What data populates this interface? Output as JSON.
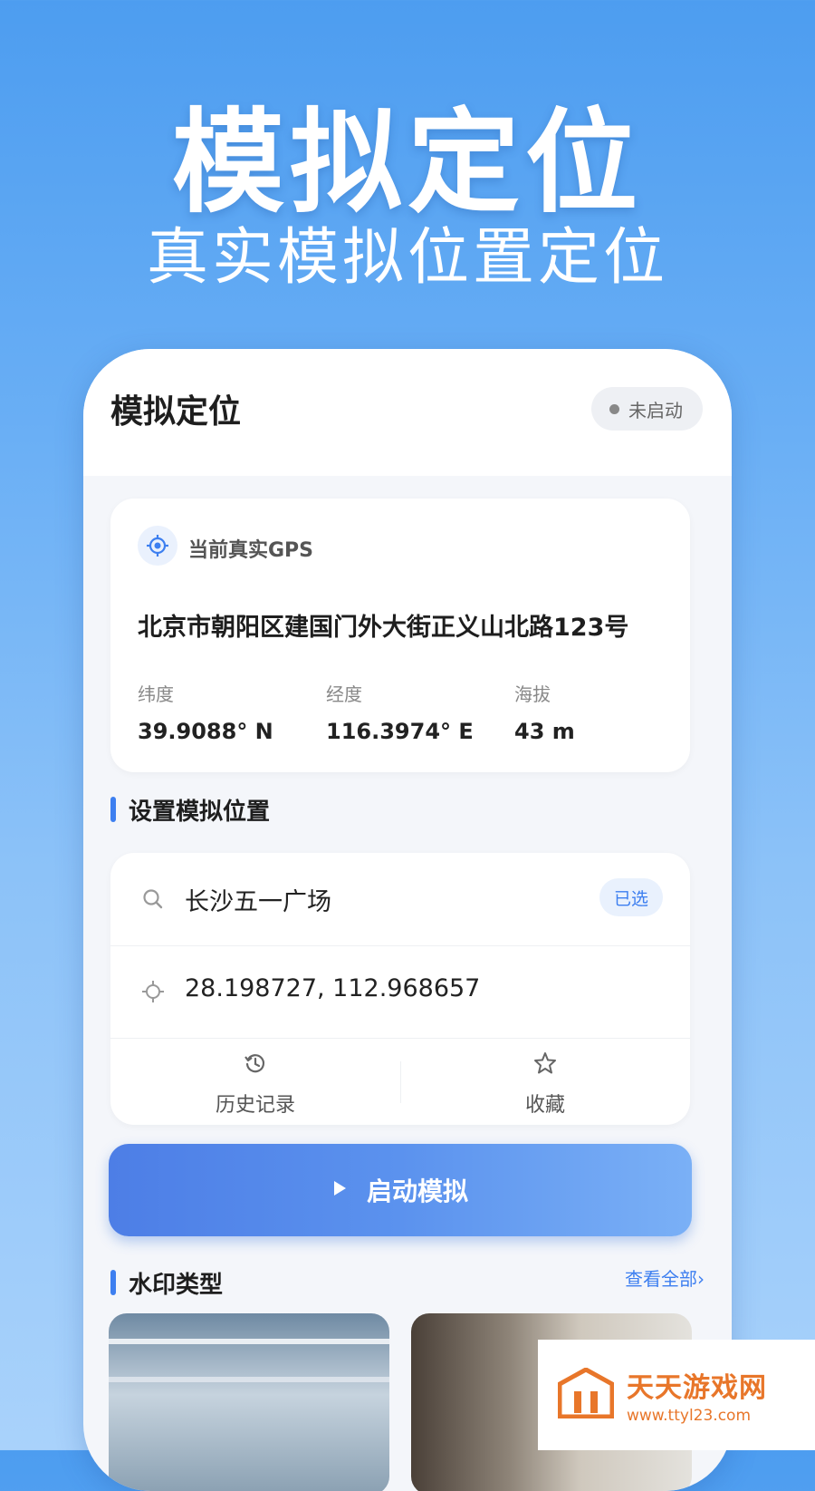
{
  "promo": {
    "title": "模拟定位",
    "subtitle": "真实模拟位置定位"
  },
  "app": {
    "title": "模拟定位",
    "status": "未启动"
  },
  "gps_card": {
    "label": "当前真实GPS",
    "address": "北京市朝阳区建国门外大街正义山北路123号",
    "coords": [
      {
        "label": "纬度",
        "value": "39.9088° N"
      },
      {
        "label": "经度",
        "value": "116.3974° E"
      },
      {
        "label": "海拔",
        "value": "43 m"
      }
    ]
  },
  "set_location": {
    "title": "设置模拟位置",
    "place": "长沙五一广场",
    "selected_tag": "已选",
    "coordinates": "28.198727, 112.968657",
    "actions": [
      {
        "label": "历史记录",
        "icon": "history-icon"
      },
      {
        "label": "收藏",
        "icon": "star-icon"
      }
    ]
  },
  "start_button": {
    "label": "启动模拟",
    "icon": "play-icon"
  },
  "watermark_types": {
    "title": "水印类型",
    "view_all": "查看全部›"
  },
  "site_watermark": {
    "name": "天天游戏网",
    "url": "www.ttyl23.com"
  },
  "colors": {
    "accent": "#3d7ff0",
    "background_top": "#4d9df0",
    "button_gradient_start": "#4d7ee6",
    "button_gradient_end": "#7ab0f6",
    "watermark_orange": "#e8762a"
  }
}
